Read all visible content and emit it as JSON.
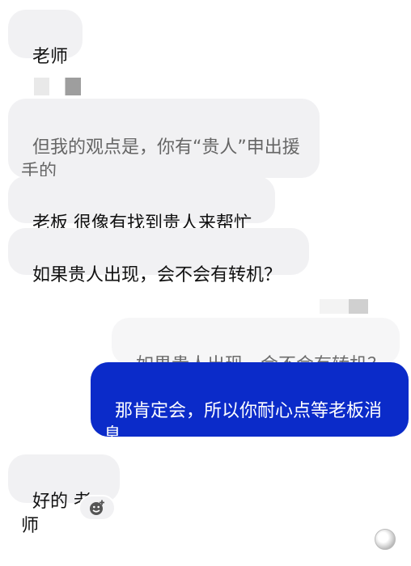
{
  "messages": [
    {
      "id": "m1",
      "text": "老师"
    },
    {
      "id": "m2",
      "text": "但我的观点是，你有“贵人”申出援\n手的"
    },
    {
      "id": "m3",
      "text": "老板 很像有找到贵人来帮忙"
    },
    {
      "id": "m4",
      "text": "如果贵人出现，会不会有转机？"
    },
    {
      "id": "quote",
      "text": "如果贵人出现，会不会有转机？"
    },
    {
      "id": "m5",
      "text": "那肯定会，所以你耐心点等老板消\n息"
    },
    {
      "id": "m6",
      "text": "好的 老师"
    }
  ],
  "colors": {
    "incoming_bubble": "#f1f1f3",
    "outgoing_bubble": "#0b2bc9",
    "outgoing_text": "#ffffff",
    "text": "#111111"
  },
  "icons": {
    "reaction": "add-reaction-icon",
    "avatar": "read-avatar-icon"
  }
}
